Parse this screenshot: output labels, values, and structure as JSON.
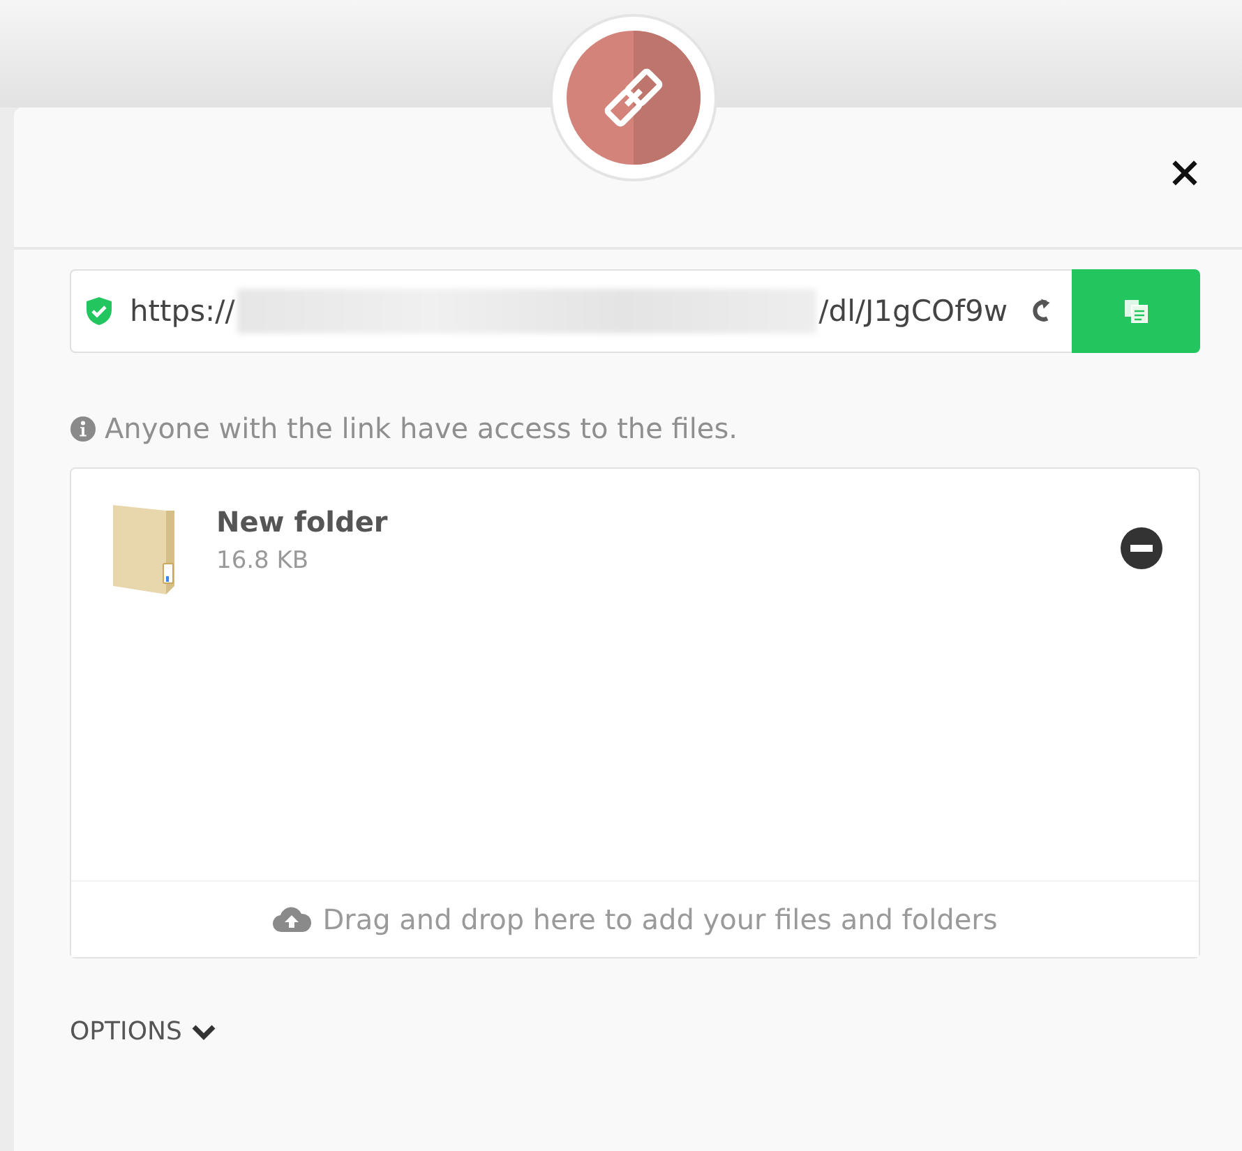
{
  "link": {
    "prefix": "https://",
    "suffix": "/dl/J1gCOf9w"
  },
  "info": "Anyone with the link have access to the files.",
  "files": [
    {
      "name": "New folder",
      "size": "16.8 KB"
    }
  ],
  "dropzone": "Drag and drop here to add your files and folders",
  "options": {
    "label": "OPTIONS",
    "expanded": false
  }
}
